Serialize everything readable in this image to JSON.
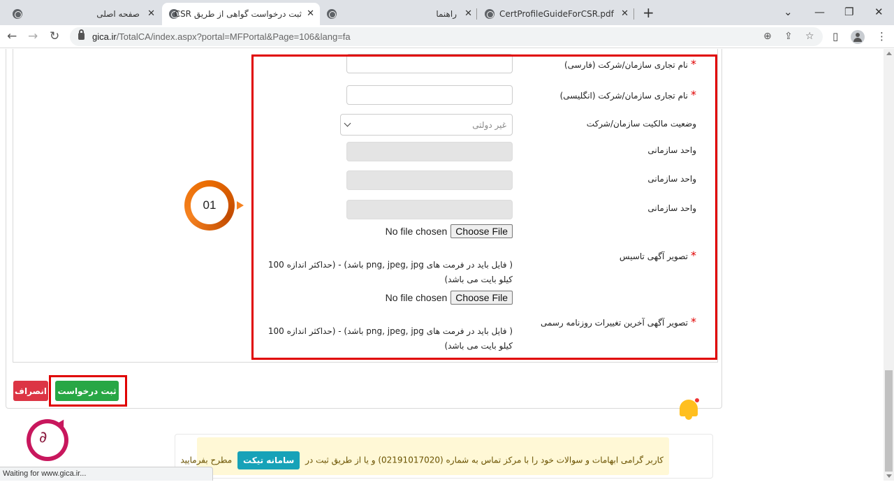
{
  "browser": {
    "tabs": [
      {
        "title": "صفحه اصلی",
        "active": false
      },
      {
        "title": "ثبت درخواست گواهی از طریق CSR",
        "active": true
      },
      {
        "title": "راهنما",
        "active": false
      },
      {
        "title": "CertProfileGuideForCSR.pdf",
        "active": false
      }
    ],
    "new_tab": "+",
    "url_host": "gica.ir",
    "url_path": "/TotalCA/index.aspx?portal=MFPortal&Page=106&lang=fa",
    "status_text": "Waiting for www.gica.ir..."
  },
  "form": {
    "fields": [
      {
        "label": "نام تجاری سازمان/شرکت (فارسی)",
        "required": true,
        "value": ""
      },
      {
        "label": "نام تجاری سازمان/شرکت (انگلیسی)",
        "required": true,
        "value": ""
      },
      {
        "label": "وضعیت مالکیت سازمان/شرکت",
        "required": false,
        "selected": "غیر دولتی"
      },
      {
        "label": "واحد سازمانی",
        "required": false,
        "value": ""
      },
      {
        "label": "واحد سازمانی",
        "required": false,
        "value": ""
      },
      {
        "label": "واحد سازمانی",
        "required": false,
        "value": ""
      }
    ],
    "uploads": [
      {
        "label": "تصویر آگهی تاسیس",
        "required": true,
        "status": "No file chosen",
        "button": "Choose File",
        "hint_line1": "( فایل باید در فرمت های png, jpeg, jpg باشد) - (حداکثر اندازه 100",
        "hint_line2": "کیلو بایت می باشد)"
      },
      {
        "label": "تصویر آگهی آخرین تغییرات روزنامه رسمی",
        "required": true,
        "status": "No file chosen",
        "button": "Choose File",
        "hint_line1": "( فایل باید در فرمت های png, jpeg, jpg باشد) - (حداکثر اندازه 100",
        "hint_line2": "کیلو بایت می باشد)"
      }
    ],
    "required_mark": "*",
    "step_badge": "01",
    "submit_label": "ثبت درخواست",
    "cancel_label": "انصراف"
  },
  "notice": {
    "text_before": "کاربر گرامی ابهامات و سوالات خود را با مرکز تماس به شماره (02191017020) و یا از طریق ثبت در",
    "ticket_label": "سامانه تیکت",
    "text_after": "مطرح بفرمایید"
  },
  "colors": {
    "highlight": "#e00000",
    "submit": "#28a745",
    "cancel": "#dc3545",
    "ticket": "#17a2b8",
    "notice_bg": "#fff8d6",
    "badge": "#e96b00"
  }
}
